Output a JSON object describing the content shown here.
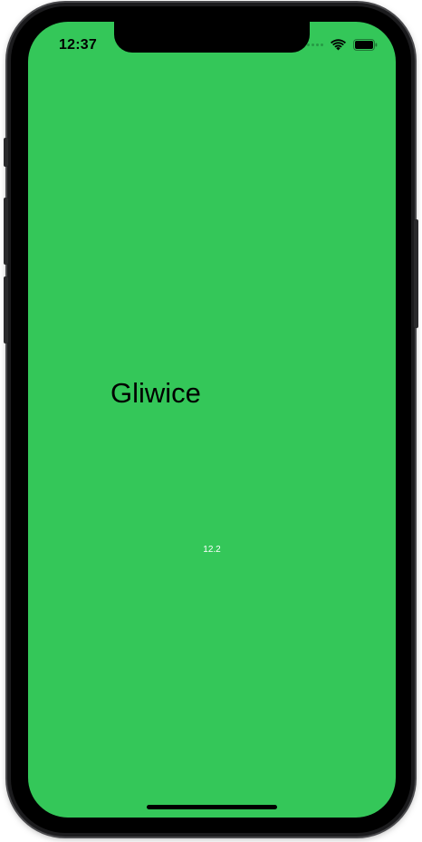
{
  "status_bar": {
    "time": "12:37",
    "icons": [
      "signal-dots-icon",
      "wifi-icon",
      "battery-icon"
    ]
  },
  "main": {
    "city": "Gliwice",
    "temperature": "12.2"
  },
  "colors": {
    "background": "#34c759",
    "city_text": "#000000",
    "temperature_text": "#ffffff",
    "device_frame": "#1b1b1d"
  }
}
